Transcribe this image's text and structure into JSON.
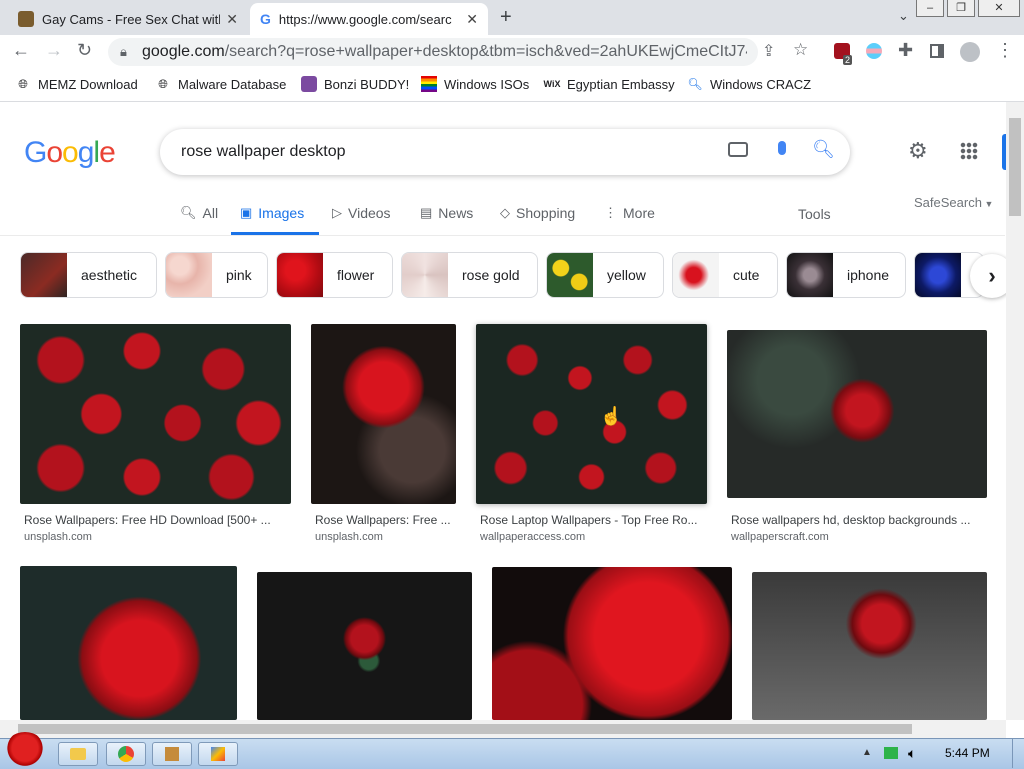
{
  "tabs": [
    {
      "title": "Gay Cams - Free Sex Chat with",
      "active": false
    },
    {
      "title": "https://www.google.com/searc",
      "active": true
    }
  ],
  "new_tab": "+",
  "address": {
    "host": "google.com",
    "path": "/search?q=rose+wallpaper+desktop&tbm=isch&ved=2ahUKEwjCmeCItJ74A..."
  },
  "extension_badge": "2",
  "bookmarks": [
    {
      "label": "MEMZ Download",
      "icon": "globe-icon"
    },
    {
      "label": "Malware Database",
      "icon": "globe-icon"
    },
    {
      "label": "Bonzi BUDDY!",
      "icon": "bonzi-icon"
    },
    {
      "label": "Windows ISOs",
      "icon": "rainbow-flag-icon"
    },
    {
      "label": "Egyptian Embassy",
      "icon": "wix-icon"
    },
    {
      "label": "Windows CRACZ",
      "icon": "search-icon"
    }
  ],
  "wix_text": "WiX",
  "logo": {
    "letters": [
      "G",
      "o",
      "o",
      "g",
      "l",
      "e"
    ],
    "colors": [
      "#4285f4",
      "#ea4335",
      "#fbbc05",
      "#4285f4",
      "#34a853",
      "#ea4335"
    ]
  },
  "search": {
    "query": "rose wallpaper desktop"
  },
  "nav_tabs": [
    {
      "label": "All",
      "icon": "search-icon"
    },
    {
      "label": "Images",
      "icon": "image-icon",
      "active": true
    },
    {
      "label": "Videos",
      "icon": "play-icon"
    },
    {
      "label": "News",
      "icon": "news-icon"
    },
    {
      "label": "Shopping",
      "icon": "tag-icon"
    },
    {
      "label": "More",
      "icon": "kebab-icon"
    }
  ],
  "tools_label": "Tools",
  "safesearch_label": "SafeSearch",
  "chips": [
    {
      "label": "aesthetic"
    },
    {
      "label": "pink"
    },
    {
      "label": "flower"
    },
    {
      "label": "rose gold"
    },
    {
      "label": "yellow"
    },
    {
      "label": "cute"
    },
    {
      "label": "iphone"
    },
    {
      "label": ""
    }
  ],
  "results": [
    {
      "caption": "Rose Wallpapers: Free HD Download [500+ ...",
      "source": "unsplash.com"
    },
    {
      "caption": "Rose Wallpapers: Free ...",
      "source": "unsplash.com"
    },
    {
      "caption": "Rose Laptop Wallpapers - Top Free Ro...",
      "source": "wallpaperaccess.com"
    },
    {
      "caption": "Rose wallpapers hd, desktop backgrounds ...",
      "source": "wallpaperscraft.com"
    },
    {
      "caption": "",
      "source": ""
    },
    {
      "caption": "",
      "source": ""
    },
    {
      "caption": "",
      "source": ""
    },
    {
      "caption": "",
      "source": ""
    }
  ],
  "taskbar": {
    "clock": "5:44 PM"
  },
  "colors": {
    "accent": "#1a73e8",
    "rose": "#b3121d",
    "dark_leaf": "#1e2a24"
  }
}
